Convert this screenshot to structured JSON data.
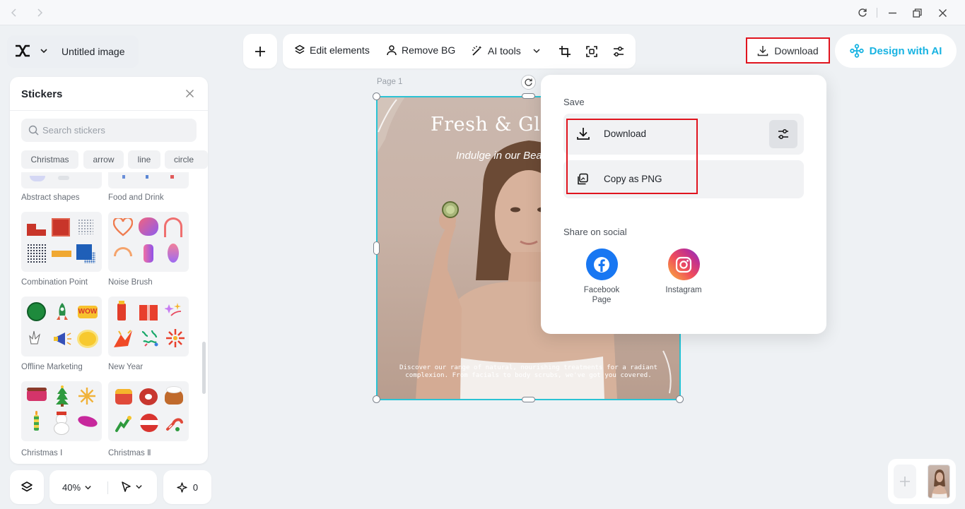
{
  "titlebar": {
    "back_icon": "chevron-left",
    "forward_icon": "chevron-right",
    "refresh_icon": "refresh",
    "minimize_icon": "minimize",
    "restore_icon": "restore",
    "close_icon": "close"
  },
  "header": {
    "doc_title": "Untitled image"
  },
  "toolbar": {
    "edit_elements": "Edit elements",
    "remove_bg": "Remove BG",
    "ai_tools": "AI tools",
    "download": "Download",
    "design_with_ai": "Design with AI"
  },
  "stickers": {
    "title": "Stickers",
    "search_placeholder": "Search stickers",
    "chips": [
      "Christmas",
      "arrow",
      "line",
      "circle"
    ],
    "top_labels": [
      "Abstract shapes",
      "Food and Drink"
    ],
    "rows": [
      [
        "Combination Point",
        "Noise Brush"
      ],
      [
        "Offline Marketing",
        "New Year"
      ],
      [
        "Christmas Ⅰ",
        "Christmas Ⅱ"
      ]
    ]
  },
  "bottom_controls": {
    "zoom": "40%",
    "credits": "0"
  },
  "canvas": {
    "page_label": "Page 1",
    "title": "Fresh & Glow",
    "subtitle": "Indulge in our Beauty",
    "body": "Discover our range of natural, nourishing treatments for a radiant complexion. From facials to body scrubs, we've got you covered."
  },
  "popover": {
    "save_heading": "Save",
    "download": "Download",
    "copy_png": "Copy as PNG",
    "share_heading": "Share on social",
    "facebook": "Facebook Page",
    "instagram": "Instagram"
  },
  "colors": {
    "accent": "#18b3e2",
    "selection": "#2bc3d4",
    "highlight": "#e0141e",
    "facebook": "#1877f2"
  }
}
